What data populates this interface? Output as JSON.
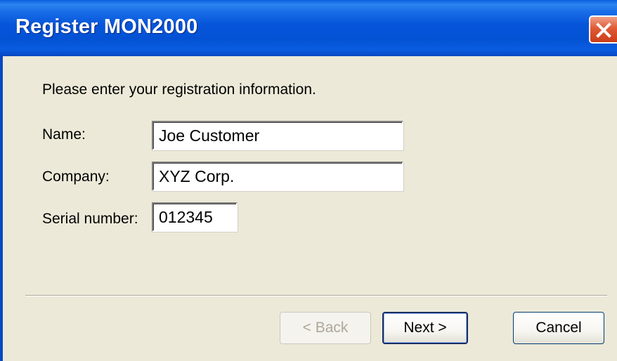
{
  "window": {
    "title": "Register MON2000"
  },
  "form": {
    "intro": "Please enter your registration information.",
    "name_label": "Name:",
    "name_value": "Joe Customer",
    "company_label": "Company:",
    "company_value": "XYZ Corp.",
    "serial_label": "Serial number:",
    "serial_value": "012345"
  },
  "buttons": {
    "back": "< Back",
    "next": "Next >",
    "cancel": "Cancel"
  },
  "colors": {
    "titlebar": "#0654d9",
    "dialog_background": "#ece9d8",
    "close_button": "#e05a35"
  },
  "icons": {
    "close": "close-icon"
  }
}
